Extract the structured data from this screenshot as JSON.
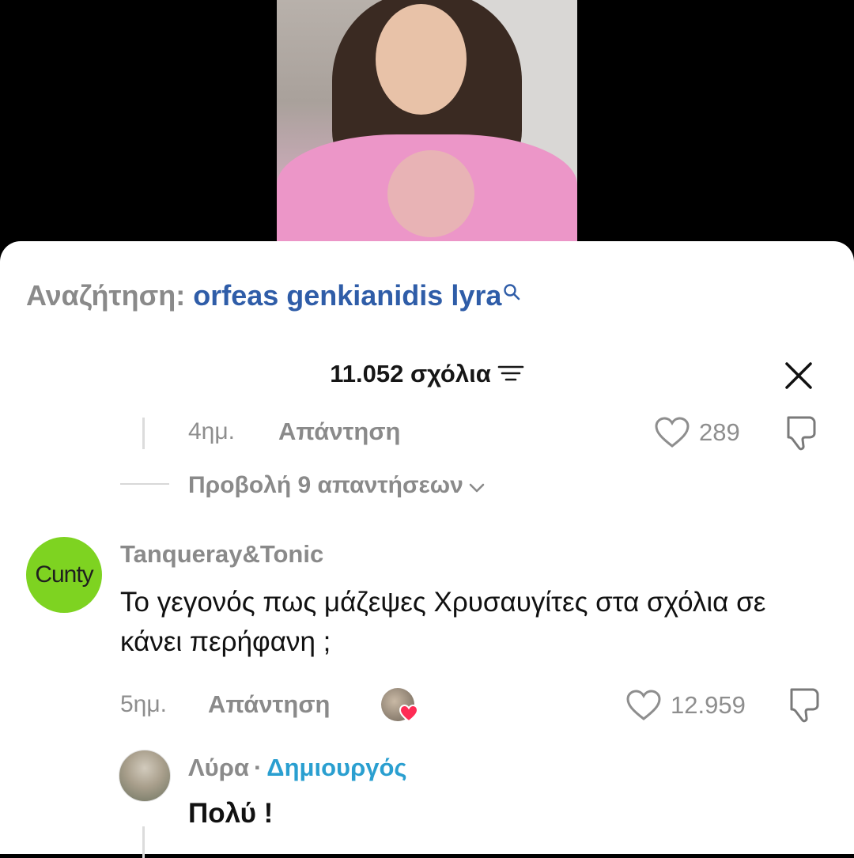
{
  "search": {
    "label": "Αναζήτηση:",
    "query": "orfeas genkianidis lyra"
  },
  "comments_header": {
    "count_label": "11.052 σχόλια"
  },
  "previous_reply": {
    "age": "4ημ.",
    "reply_label": "Απάντηση",
    "likes": "289"
  },
  "view_replies": {
    "label": "Προβολή 9 απαντήσεων"
  },
  "comment": {
    "avatar_text": "Cunty",
    "username": "Tanqueray&Tonic",
    "text": "Το γεγονός πως μάζεψες Χρυσαυγίτες στα σχόλια σε κάνει περήφανη ;",
    "age": "5ημ.",
    "reply_label": "Απάντηση",
    "likes": "12.959"
  },
  "creator_reply": {
    "username": "Λύρα",
    "separator": "·",
    "badge": "Δημιουργός",
    "text": "Πολύ !"
  },
  "colors": {
    "link_blue": "#2f5da8",
    "creator_blue": "#2a9fd0",
    "avatar_green": "#7ed321",
    "like_red": "#fe2c55"
  }
}
